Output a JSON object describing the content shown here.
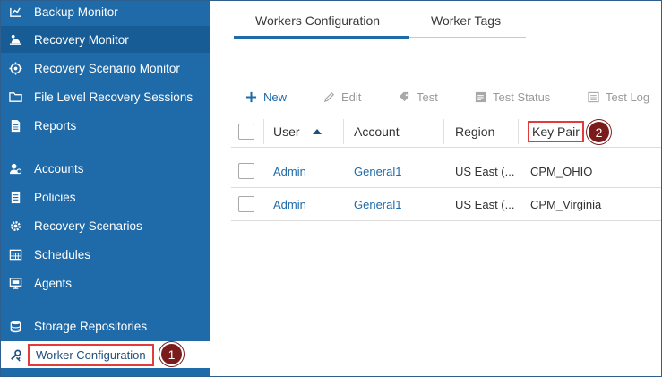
{
  "sidebar": {
    "items": [
      {
        "label": "Backup Monitor",
        "icon": "backup-monitor-icon"
      },
      {
        "label": "Recovery Monitor",
        "icon": "recovery-monitor-icon"
      },
      {
        "label": "Recovery Scenario Monitor",
        "icon": "scenario-monitor-icon"
      },
      {
        "label": "File Level Recovery Sessions",
        "icon": "folder-icon"
      },
      {
        "label": "Reports",
        "icon": "report-icon"
      },
      {
        "label": "Accounts",
        "icon": "accounts-icon"
      },
      {
        "label": "Policies",
        "icon": "policies-icon"
      },
      {
        "label": "Recovery Scenarios",
        "icon": "gear-icon"
      },
      {
        "label": "Schedules",
        "icon": "calendar-icon"
      },
      {
        "label": "Agents",
        "icon": "monitor-icon"
      },
      {
        "label": "Storage Repositories",
        "icon": "database-icon"
      },
      {
        "label": "Worker Configuration",
        "icon": "tools-icon",
        "active": true
      }
    ]
  },
  "callouts": [
    "1",
    "2"
  ],
  "tabs": [
    {
      "label": "Workers Configuration",
      "active": true
    },
    {
      "label": "Worker Tags",
      "active": false
    }
  ],
  "toolbar": {
    "new_label": "New",
    "edit_label": "Edit",
    "test_label": "Test",
    "test_status_label": "Test Status",
    "test_log_label": "Test Log"
  },
  "grid": {
    "columns": [
      "User",
      "Account",
      "Region",
      "Key Pair"
    ],
    "sort_column": "User",
    "sort_direction": "ascending",
    "rows": [
      {
        "user": "Admin",
        "account": "General1",
        "region": "US East (...",
        "key_pair": "CPM_OHIO"
      },
      {
        "user": "Admin",
        "account": "General1",
        "region": "US East (...",
        "key_pair": "CPM_Virginia"
      }
    ]
  },
  "colors": {
    "sidebar": "#1f6aa8",
    "accent": "#1f6aa8",
    "highlight_box": "#e23b3b",
    "callout_badge": "#7a1c1c"
  }
}
